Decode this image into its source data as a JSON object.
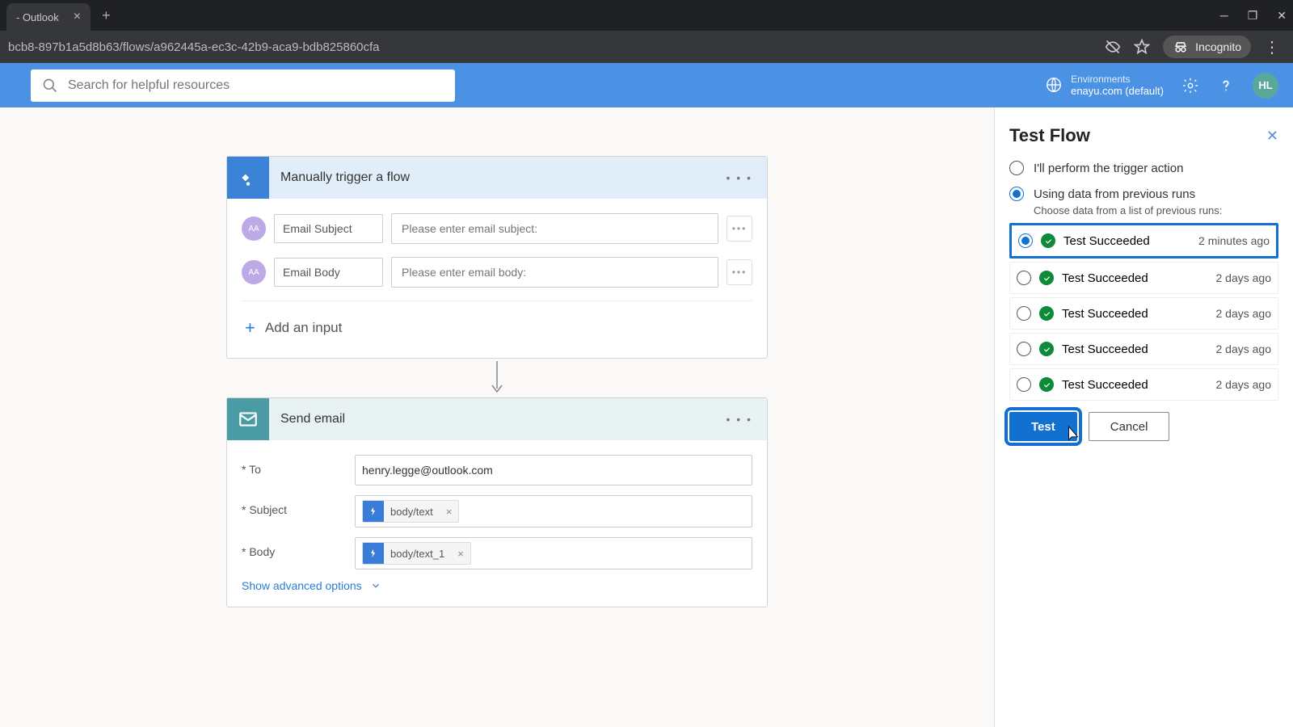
{
  "browser": {
    "tab_title": " - Outlook",
    "url": "bcb8-897b1a5d8b63/flows/a962445a-ec3c-42b9-aca9-bdb825860cfa",
    "incognito_label": "Incognito"
  },
  "header": {
    "search_placeholder": "Search for helpful resources",
    "env_label": "Environments",
    "env_value": "enayu.com (default)",
    "avatar": "HL"
  },
  "trigger_card": {
    "title": "Manually trigger a flow",
    "inputs": [
      {
        "label": "Email Subject",
        "placeholder": "Please enter email subject:"
      },
      {
        "label": "Email Body",
        "placeholder": "Please enter email body:"
      }
    ],
    "add_input": "Add an input"
  },
  "action_card": {
    "title": "Send email",
    "fields": {
      "to_label": "* To",
      "to_value": "henry.legge@outlook.com",
      "subject_label": "* Subject",
      "subject_token": "body/text",
      "body_label": "* Body",
      "body_token": "body/text_1"
    },
    "advanced": "Show advanced options"
  },
  "panel": {
    "title": "Test Flow",
    "option_manual": "I'll perform the trigger action",
    "option_previous": "Using data from previous runs",
    "choose_note": "Choose data from a list of previous runs:",
    "runs": [
      {
        "status": "Test Succeeded",
        "time": "2 minutes ago",
        "selected": true,
        "highlighted": true
      },
      {
        "status": "Test Succeeded",
        "time": "2 days ago",
        "selected": false,
        "highlighted": false
      },
      {
        "status": "Test Succeeded",
        "time": "2 days ago",
        "selected": false,
        "highlighted": false
      },
      {
        "status": "Test Succeeded",
        "time": "2 days ago",
        "selected": false,
        "highlighted": false
      },
      {
        "status": "Test Succeeded",
        "time": "2 days ago",
        "selected": false,
        "highlighted": false
      }
    ],
    "test_button": "Test",
    "cancel_button": "Cancel"
  }
}
